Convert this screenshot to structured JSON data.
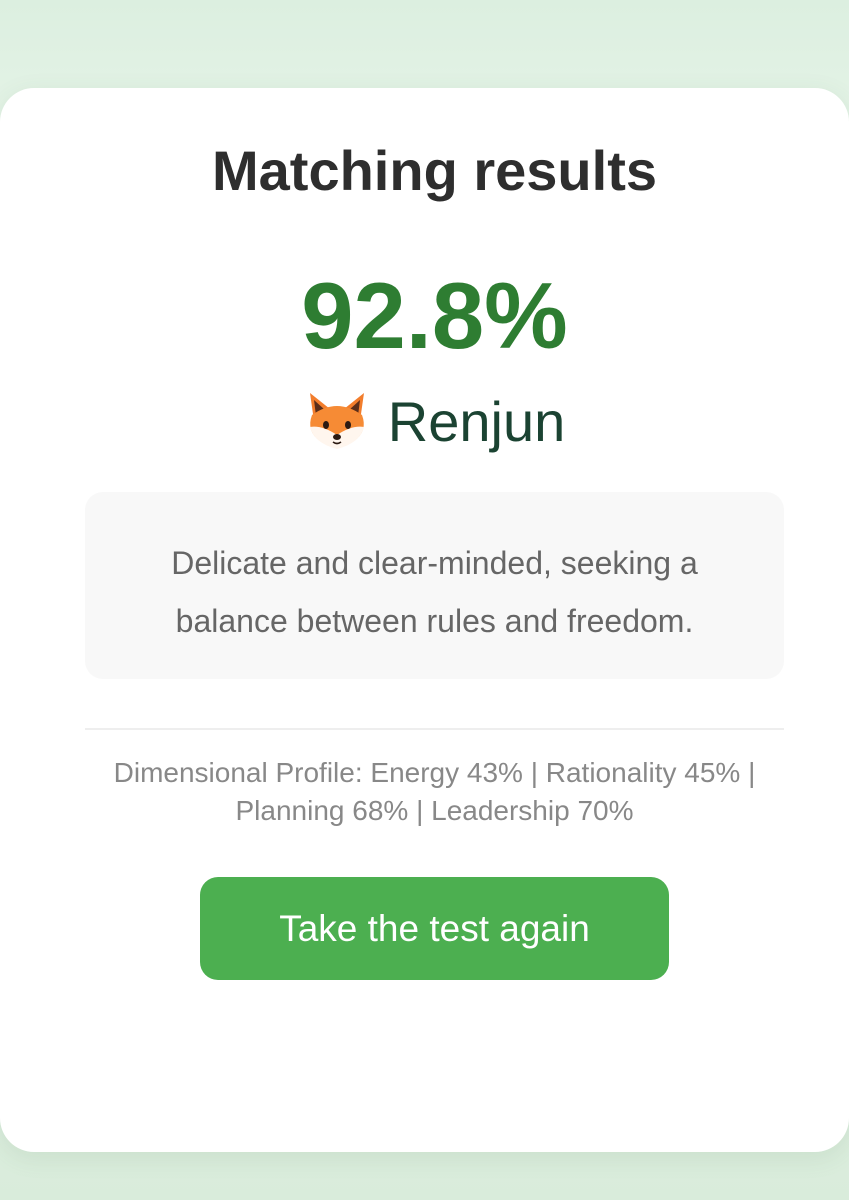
{
  "result": {
    "title": "Matching results",
    "score": "92.8%",
    "character": {
      "icon": "fox-icon",
      "name": "Renjun"
    },
    "description_line1": "Delicate and clear-minded, seeking a",
    "description_line2": "balance between rules and freedom.",
    "profile_line1": "Dimensional Profile: Energy 43% | Rationality 45% |",
    "profile_line2": "Planning 68% | Leadership 70%",
    "retake_label": "Take the test again"
  },
  "colors": {
    "accent": "#2e7d32",
    "button": "#4caf50",
    "background": "#e6f4e8"
  }
}
